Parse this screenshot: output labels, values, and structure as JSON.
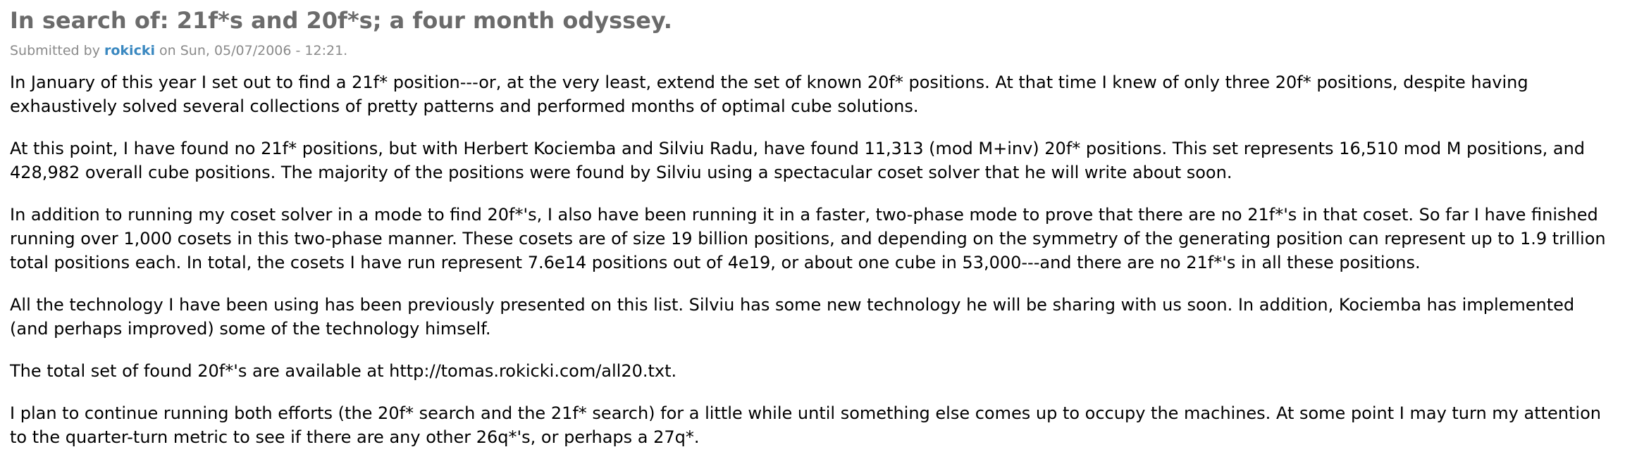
{
  "post": {
    "title": "In search of: 21f*s and 20f*s; a four month odyssey.",
    "submitted_prefix": "Submitted by",
    "author": "rokicki",
    "submitted_middle": "on",
    "date": "Sun, 05/07/2006 - 12:21.",
    "paragraphs": [
      "In January of this year I set out to find a 21f* position---or, at the very least, extend the set of known 20f* positions. At that time I knew of only three 20f* positions, despite having exhaustively solved several collections of pretty patterns and performed months of optimal cube solutions.",
      "At this point, I have found no 21f* positions, but with Herbert Kociemba and Silviu Radu, have found 11,313 (mod M+inv) 20f* positions. This set represents 16,510 mod M positions, and 428,982 overall cube positions. The majority of the positions were found by Silviu using a spectacular coset solver that he will write about soon.",
      "In addition to running my coset solver in a mode to find 20f*'s, I also have been running it in a faster, two-phase mode to prove that there are no 21f*'s in that coset. So far I have finished running over 1,000 cosets in this two-phase manner. These cosets are of size 19 billion positions, and depending on the symmetry of the generating position can represent up to 1.9 trillion total positions each. In total, the cosets I have run represent 7.6e14 positions out of 4e19, or about one cube in 53,000---and there are no 21f*'s in all these positions.",
      "All the technology I have been using has been previously presented on this list. Silviu has some new technology he will be sharing with us soon. In addition, Kociemba has implemented (and perhaps improved) some of the technology himself.",
      "The total set of found 20f*'s are available at http://tomas.rokicki.com/all20.txt.",
      "I plan to continue running both efforts (the 20f* search and the 21f* search) for a little while until something else comes up to occupy the machines. At some point I may turn my attention to the quarter-turn metric to see if there are any other 26q*'s, or perhaps a 27q*."
    ]
  },
  "colors": {
    "title": "#6b6b6b",
    "meta": "#8a8a8a",
    "link": "#3a88c0",
    "text": "#000000",
    "background": "#ffffff"
  }
}
